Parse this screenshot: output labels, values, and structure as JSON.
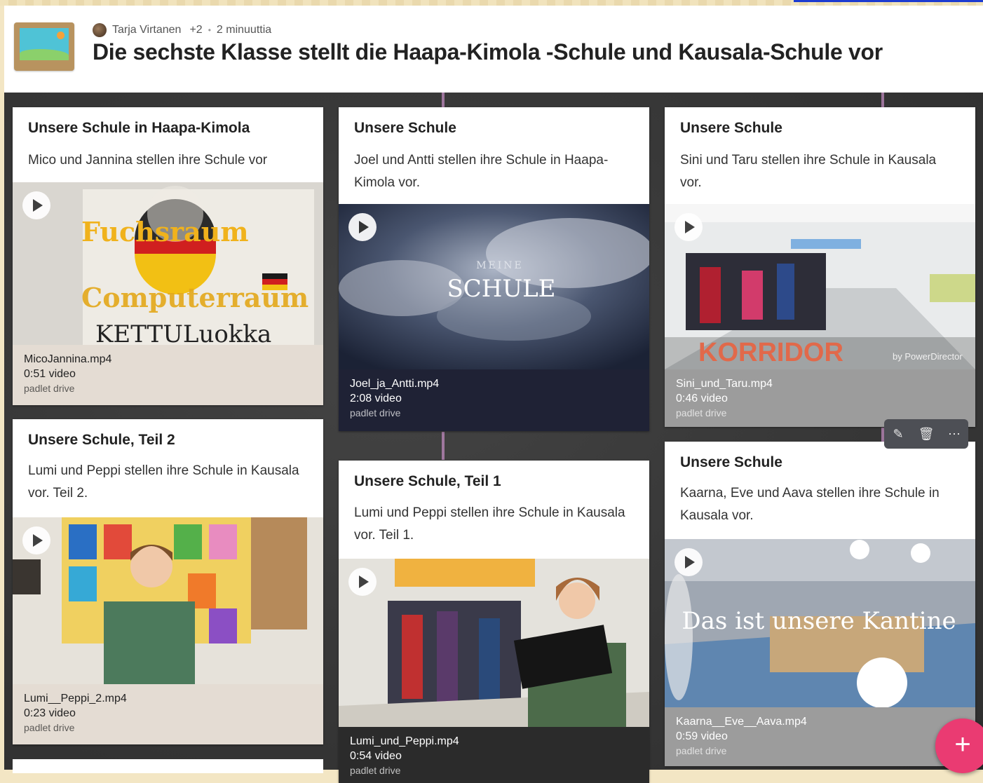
{
  "header": {
    "author": "Tarja Virtanen",
    "collaborators": "+2",
    "time_ago": "2 minuuttia",
    "title": "Die sechste Klasse stellt die Haapa-Kimola -Schule und Kausala-Schule vor"
  },
  "posts": [
    {
      "title": "Unsere Schule in Haapa-Kimola",
      "description": "Mico und Jannina stellen ihre Schule vor",
      "file": "MicoJannina.mp4",
      "length": "0:51 video",
      "source": "padlet drive",
      "overlay_top": "Fuchsraum",
      "overlay_bottom": "Computerraum",
      "overlay_sign": "KETTULuokka"
    },
    {
      "title": "Unsere Schule",
      "description": "Joel und Antti stellen ihre Schule in Haapa-Kimola vor.",
      "file": "Joel_ja_Antti.mp4",
      "length": "2:08 video",
      "source": "padlet drive",
      "overlay_small": "MEINE",
      "overlay_big": "SCHULE"
    },
    {
      "title": "Unsere Schule",
      "description": "Sini und Taru stellen ihre Schule in Kausala vor.",
      "file": "Sini_und_Taru.mp4",
      "length": "0:46 video",
      "source": "padlet drive",
      "overlay_big": "KORRIDOR",
      "overlay_small": "by PowerDirector"
    },
    {
      "title": "Unsere Schule, Teil 2",
      "description": "Lumi und Peppi stellen ihre Schule in Kausala vor. Teil 2.",
      "file": "Lumi__Peppi_2.mp4",
      "length": "0:23 video",
      "source": "padlet drive"
    },
    {
      "title": "Unsere Schule, Teil 1",
      "description": "Lumi und Peppi stellen ihre Schule in Kausala vor. Teil 1.",
      "file": "Lumi_und_Peppi.mp4",
      "length": "0:54 video",
      "source": "padlet drive"
    },
    {
      "title": "Unsere Schule",
      "description": "Kaarna, Eve und Aava stellen ihre Schule in Kausala vor.",
      "file": "Kaarna__Eve__Aava.mp4",
      "length": "0:59 video",
      "source": "padlet drive",
      "overlay_big": "Das ist unsere Kantine"
    }
  ],
  "toolbar": {
    "edit_icon": "✎",
    "delete_icon": "🗑",
    "more_icon": "⋯"
  },
  "fab": {
    "label": "+"
  },
  "colors": {
    "accent": "#ea3b72",
    "wall": "#3a3a3a"
  }
}
